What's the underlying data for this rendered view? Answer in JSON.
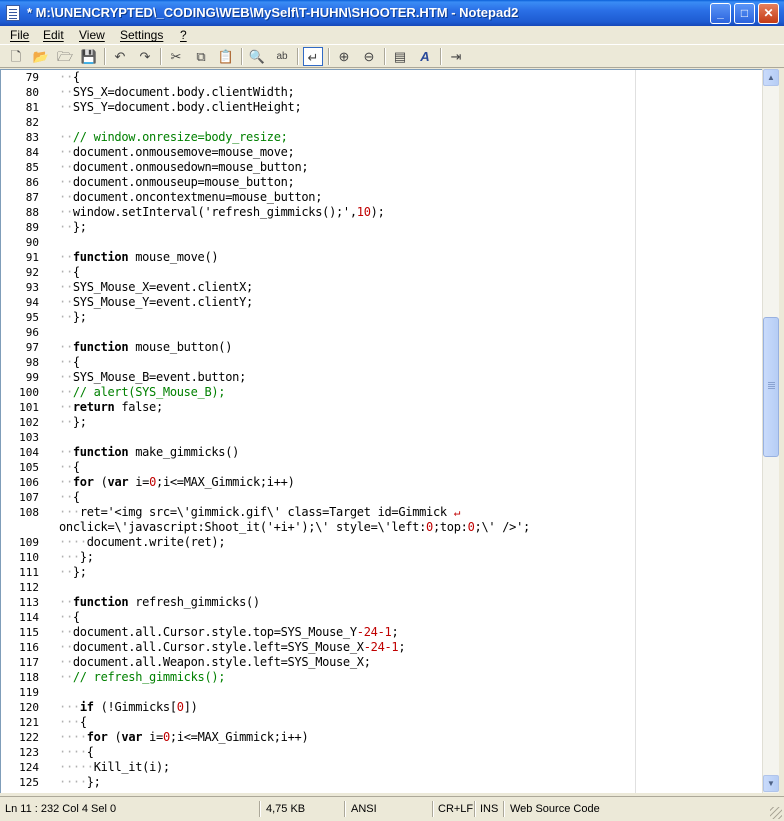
{
  "window": {
    "title": "* M:\\UNENCRYPTED\\_CODING\\WEB\\MySelf\\T-HUHN\\SHOOTER.HTM - Notepad2",
    "minimize_label": "_",
    "maximize_label": "□",
    "close_label": "✕"
  },
  "menu": [
    {
      "label": "File"
    },
    {
      "label": "Edit"
    },
    {
      "label": "View"
    },
    {
      "label": "Settings"
    },
    {
      "label": "?"
    }
  ],
  "toolbar": [
    {
      "name": "new-file-icon",
      "glyph": "🗋"
    },
    {
      "name": "open-folder-icon",
      "glyph": "📂"
    },
    {
      "name": "browse-icon",
      "glyph": "🗁"
    },
    {
      "name": "save-icon",
      "glyph": "💾"
    },
    {
      "name": "undo-icon",
      "glyph": "↶"
    },
    {
      "name": "redo-icon",
      "glyph": "↷"
    },
    {
      "name": "cut-icon",
      "glyph": "✂"
    },
    {
      "name": "copy-icon",
      "glyph": "⧉"
    },
    {
      "name": "paste-icon",
      "glyph": "📋"
    },
    {
      "name": "find-icon",
      "glyph": "🔍"
    },
    {
      "name": "replace-icon",
      "glyph": "ab"
    },
    {
      "name": "word-wrap-icon",
      "glyph": "↵"
    },
    {
      "name": "zoom-in-icon",
      "glyph": "⊕"
    },
    {
      "name": "zoom-out-icon",
      "glyph": "⊖"
    },
    {
      "name": "scheme-icon",
      "glyph": "▤"
    },
    {
      "name": "customize-scheme-icon",
      "glyph": "A"
    },
    {
      "name": "exit-icon",
      "glyph": "⇥"
    }
  ],
  "editor": {
    "lines": [
      {
        "n": "79",
        "code": "··{"
      },
      {
        "n": "80",
        "code": "··SYS_X=document.body.clientWidth;"
      },
      {
        "n": "81",
        "code": "··SYS_Y=document.body.clientHeight;"
      },
      {
        "n": "82",
        "code": ""
      },
      {
        "n": "83",
        "code": "··// window.onresize=body_resize;",
        "cls": "cm"
      },
      {
        "n": "84",
        "code": "··document.onmousemove=mouse_move;"
      },
      {
        "n": "85",
        "code": "··document.onmousedown=mouse_button;"
      },
      {
        "n": "86",
        "code": "··document.onmouseup=mouse_button;"
      },
      {
        "n": "87",
        "code": "··document.oncontextmenu=mouse_button;"
      },
      {
        "n": "88",
        "code": "··window.setInterval('refresh_gimmicks();',10);"
      },
      {
        "n": "89",
        "code": "··};"
      },
      {
        "n": "90",
        "code": ""
      },
      {
        "n": "91",
        "code": "··function mouse_move()"
      },
      {
        "n": "92",
        "code": "··{"
      },
      {
        "n": "93",
        "code": "··SYS_Mouse_X=event.clientX;"
      },
      {
        "n": "94",
        "code": "··SYS_Mouse_Y=event.clientY;"
      },
      {
        "n": "95",
        "code": "··};"
      },
      {
        "n": "96",
        "code": ""
      },
      {
        "n": "97",
        "code": "··function mouse_button()"
      },
      {
        "n": "98",
        "code": "··{"
      },
      {
        "n": "99",
        "code": "··SYS_Mouse_B=event.button;"
      },
      {
        "n": "100",
        "code": "··// alert(SYS_Mouse_B);",
        "cls": "cm"
      },
      {
        "n": "101",
        "code": "··return false;"
      },
      {
        "n": "102",
        "code": "··};"
      },
      {
        "n": "103",
        "code": ""
      },
      {
        "n": "104",
        "code": "··function make_gimmicks()"
      },
      {
        "n": "105",
        "code": "··{"
      },
      {
        "n": "106",
        "code": "··for (var i=0;i<=MAX_Gimmick;i++)"
      },
      {
        "n": "107",
        "code": "··{"
      },
      {
        "n": "108",
        "code": "···ret='<img src=\\'gimmick.gif\\' class=Target id=Gimmick ↵"
      },
      {
        "n": "",
        "code": "onclick=\\'javascript:Shoot_it('+i+');\\' style=\\'left:0;top:0;\\' />';"
      },
      {
        "n": "109",
        "code": "····document.write(ret);"
      },
      {
        "n": "110",
        "code": "···};"
      },
      {
        "n": "111",
        "code": "··};"
      },
      {
        "n": "112",
        "code": ""
      },
      {
        "n": "113",
        "code": "··function refresh_gimmicks()"
      },
      {
        "n": "114",
        "code": "··{"
      },
      {
        "n": "115",
        "code": "··document.all.Cursor.style.top=SYS_Mouse_Y-24-1;"
      },
      {
        "n": "116",
        "code": "··document.all.Cursor.style.left=SYS_Mouse_X-24-1;"
      },
      {
        "n": "117",
        "code": "··document.all.Weapon.style.left=SYS_Mouse_X;"
      },
      {
        "n": "118",
        "code": "··// refresh_gimmicks();",
        "cls": "cm"
      },
      {
        "n": "119",
        "code": ""
      },
      {
        "n": "120",
        "code": "···if (!Gimmicks[0])"
      },
      {
        "n": "121",
        "code": "···{"
      },
      {
        "n": "122",
        "code": "····for (var i=0;i<=MAX_Gimmick;i++)"
      },
      {
        "n": "123",
        "code": "····{"
      },
      {
        "n": "124",
        "code": "·····Kill_it(i);"
      },
      {
        "n": "125",
        "code": "····};"
      }
    ]
  },
  "status": {
    "position": "Ln 11 : 232   Col 4   Sel 0",
    "size": "4,75 KB",
    "encoding": "ANSI",
    "line_endings": "CR+LF",
    "mode": "INS",
    "scheme": "Web Source Code"
  },
  "scrollbar": {
    "up": "▲",
    "down": "▼"
  }
}
